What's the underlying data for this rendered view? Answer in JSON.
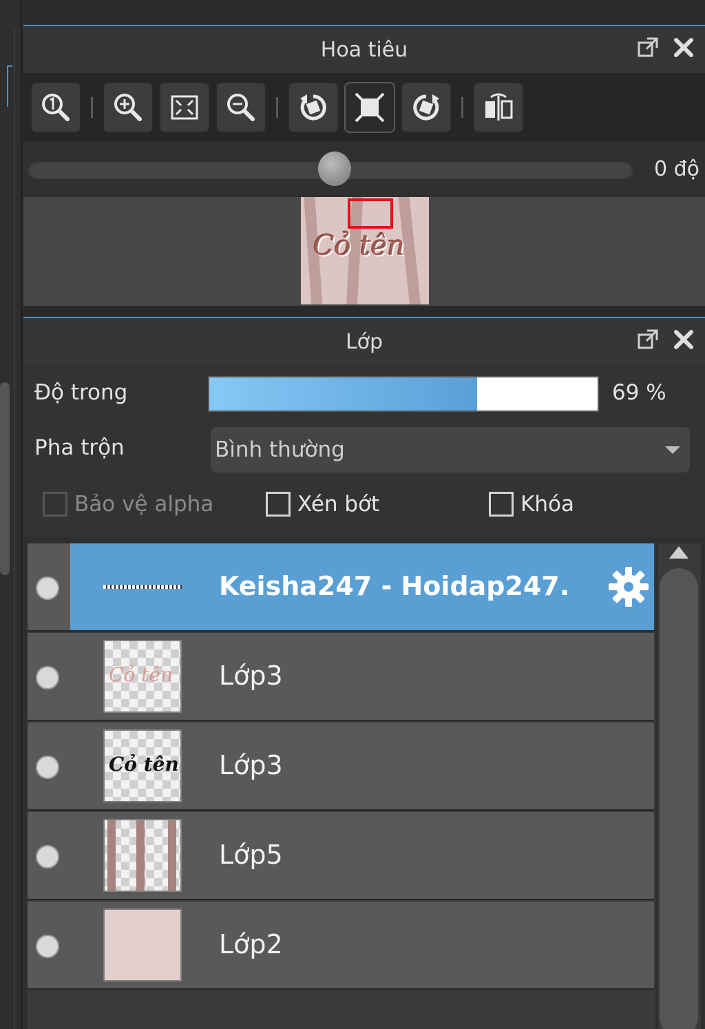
{
  "navigator": {
    "title": "Hoa tiêu",
    "toolbar": {
      "buttons": [
        "zoom-actual-size",
        "zoom-in",
        "fit-to-window",
        "zoom-out",
        "rotate-left",
        "reset-rotation",
        "rotate-right",
        "flip-horizontal"
      ]
    },
    "rotation": {
      "value_text": "0 độ",
      "slider_fraction": 0.5
    },
    "preview": {
      "text": "Cỏ tên"
    }
  },
  "layers_panel": {
    "title": "Lớp",
    "opacity": {
      "label": "Độ trong",
      "value": 69,
      "value_text": "69 %"
    },
    "blend": {
      "label": "Pha trộn",
      "value": "Bình thường"
    },
    "checkboxes": {
      "protect_alpha": {
        "label": "Bảo vệ alpha",
        "checked": false,
        "enabled": false
      },
      "clipping": {
        "label": "Xén bớt",
        "checked": false,
        "enabled": true
      },
      "lock": {
        "label": "Khóa",
        "checked": false,
        "enabled": true
      }
    },
    "layers": [
      {
        "name": "Keisha247 - Hoidap247.",
        "selected": true,
        "thumb": "line"
      },
      {
        "name": "Lớp3",
        "selected": false,
        "thumb": "pink-text",
        "thumb_text": "Cỏ tên"
      },
      {
        "name": "Lớp3",
        "selected": false,
        "thumb": "black-text",
        "thumb_text": "Cỏ tên"
      },
      {
        "name": "Lớp5",
        "selected": false,
        "thumb": "stripes"
      },
      {
        "name": "Lớp2",
        "selected": false,
        "thumb": "solid-pink"
      }
    ]
  },
  "colors": {
    "accent": "#4a90c8",
    "selected_row": "#5a9fd4",
    "viewport_box": "#e0141b"
  }
}
